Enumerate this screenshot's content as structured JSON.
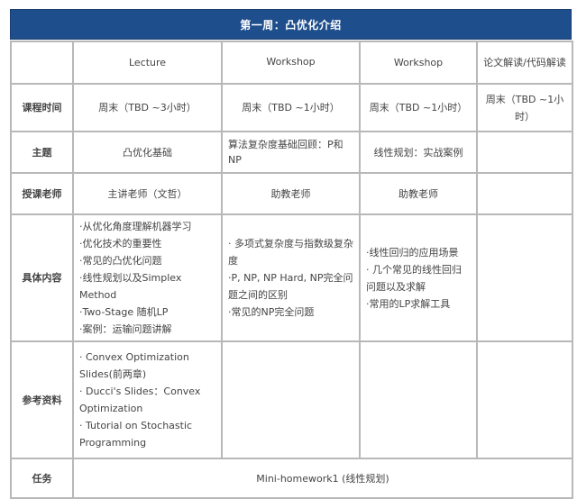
{
  "title": "第一周：凸优化介绍",
  "colors": {
    "title_band": "#1f4e8c",
    "title_text": "#ffffff",
    "grid_line": "#b8b8b8"
  },
  "columns": [
    "",
    "Lecture",
    "Workshop",
    "Workshop",
    "论文解读/代码解读"
  ],
  "rows": {
    "time": {
      "label": "课程时间",
      "cells": [
        "周末（TBD ~3小时）",
        "周末（TBD ~1小时）",
        "周末（TBD ~1小时）",
        "周末（TBD ~1小时）"
      ]
    },
    "topic": {
      "label": "主题",
      "cells": [
        "凸优化基础",
        "算法复杂度基础回顾：P和NP",
        "线性规划：实战案例",
        ""
      ]
    },
    "teacher": {
      "label": "授课老师",
      "cells": [
        "主讲老师（文哲）",
        "助教老师",
        "助教老师",
        ""
      ]
    },
    "content": {
      "label": "具体内容",
      "cells": [
        [
          "·从优化角度理解机器学习",
          "·优化技术的重要性",
          "·常见的凸优化问题",
          "·线性规划以及Simplex Method",
          "·Two-Stage 随机LP",
          "·案例：运输问题讲解"
        ],
        [
          "· 多项式复杂度与指数级复杂度",
          "·P, NP, NP Hard, NP完全问题之间的区别",
          "·常见的NP完全问题"
        ],
        [
          "·线性回归的应用场景",
          "· 几个常见的线性回归问题以及求解",
          "·常用的LP求解工具"
        ],
        []
      ]
    },
    "references": {
      "label": "参考资料",
      "cells": [
        [
          "· Convex Optimization Slides(前两章)",
          "· Ducci's Slides：Convex Optimization",
          "· Tutorial on Stochastic Programming"
        ],
        [],
        [],
        []
      ]
    },
    "task": {
      "label": "任务",
      "value": "Mini-homework1 (线性规划)"
    }
  }
}
